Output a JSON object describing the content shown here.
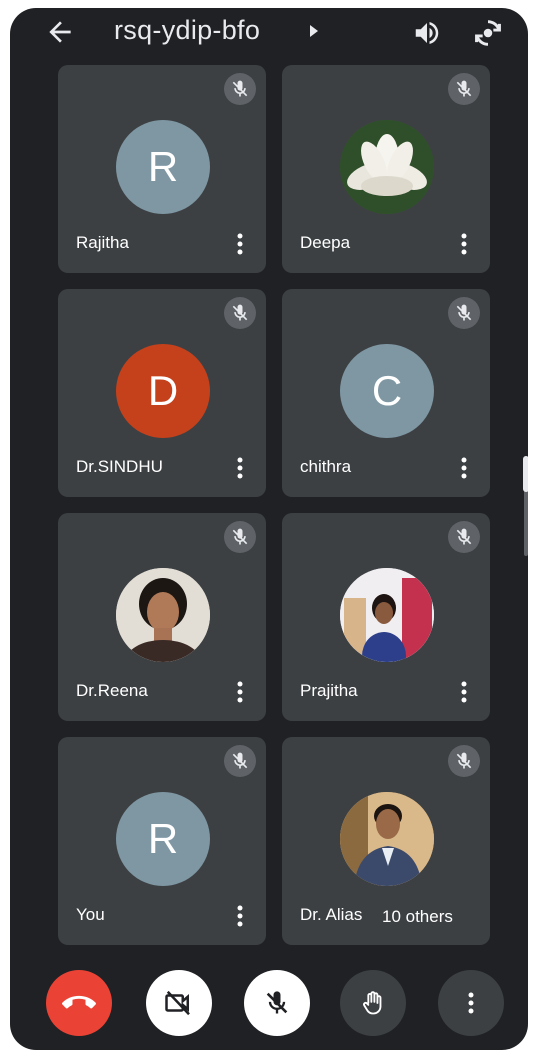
{
  "meeting": {
    "code": "rsq-ydip-bfo"
  },
  "colors": {
    "background": "#202124",
    "tile": "#3c4043",
    "end_call": "#ea4335",
    "avatar_slate": "#7e97a3",
    "avatar_orange": "#c5411b"
  },
  "participants": [
    {
      "name": "Rajitha",
      "initial": "R",
      "avatar_type": "letter",
      "avatar_color": "#7e97a3",
      "muted": true
    },
    {
      "name": "Deepa",
      "initial": "",
      "avatar_type": "photo-flower",
      "muted": true
    },
    {
      "name": "Dr.SINDHU",
      "initial": "D",
      "avatar_type": "letter",
      "avatar_color": "#c5411b",
      "muted": true
    },
    {
      "name": "chithra",
      "initial": "C",
      "avatar_type": "letter",
      "avatar_color": "#7e97a3",
      "muted": true
    },
    {
      "name": "Dr.Reena",
      "initial": "",
      "avatar_type": "photo-person",
      "muted": true
    },
    {
      "name": "Prajitha",
      "initial": "",
      "avatar_type": "photo-person",
      "muted": true
    },
    {
      "name": "You",
      "initial": "R",
      "avatar_type": "letter",
      "avatar_color": "#7e97a3",
      "muted": true
    },
    {
      "name": "Dr. Alias",
      "initial": "",
      "avatar_type": "photo-person",
      "muted": true
    }
  ],
  "others_badge": "10 others",
  "controls": [
    {
      "name": "end-call",
      "icon": "phone-hangup-icon"
    },
    {
      "name": "camera-off",
      "icon": "video-off-icon"
    },
    {
      "name": "mic-off",
      "icon": "mic-off-icon"
    },
    {
      "name": "raise-hand",
      "icon": "hand-icon"
    },
    {
      "name": "more-options",
      "icon": "more-vertical-icon"
    }
  ]
}
